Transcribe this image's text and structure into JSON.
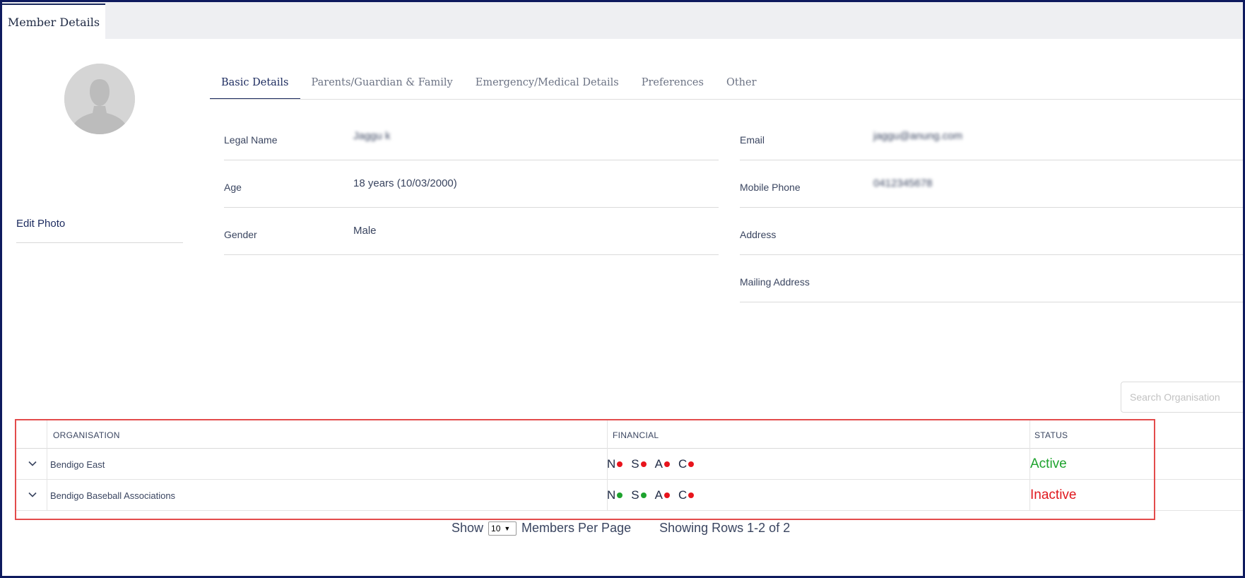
{
  "header": {
    "tab_label": "Member Details"
  },
  "profile": {
    "edit_photo_label": "Edit Photo"
  },
  "subtabs": [
    {
      "label": "Basic Details",
      "active": true
    },
    {
      "label": "Parents/Guardian & Family",
      "active": false
    },
    {
      "label": "Emergency/Medical Details",
      "active": false
    },
    {
      "label": "Preferences",
      "active": false
    },
    {
      "label": "Other",
      "active": false
    }
  ],
  "details_left": {
    "legal_name": {
      "label": "Legal Name",
      "value": "Jaggu k"
    },
    "age": {
      "label": "Age",
      "value": "18 years (10/03/2000)"
    },
    "gender": {
      "label": "Gender",
      "value": "Male"
    }
  },
  "details_right": {
    "email": {
      "label": "Email",
      "value": "jaggu@anung.com"
    },
    "mobile": {
      "label": "Mobile Phone",
      "value": "0412345678"
    },
    "address": {
      "label": "Address",
      "value": ""
    },
    "mailing": {
      "label": "Mailing Address",
      "value": ""
    }
  },
  "search": {
    "placeholder": "Search Organisation"
  },
  "table": {
    "columns": {
      "organisation": "ORGANISATION",
      "financial": "FINANCIAL",
      "status": "STATUS"
    },
    "rows": [
      {
        "organisation": "Bendigo East",
        "financial": [
          {
            "letter": "N",
            "status": "red"
          },
          {
            "letter": "S",
            "status": "red"
          },
          {
            "letter": "A",
            "status": "red"
          },
          {
            "letter": "C",
            "status": "red"
          }
        ],
        "status": "Active",
        "status_color": "#1ea32e"
      },
      {
        "organisation": "Bendigo Baseball Associations",
        "financial": [
          {
            "letter": "N",
            "status": "green"
          },
          {
            "letter": "S",
            "status": "green"
          },
          {
            "letter": "A",
            "status": "red"
          },
          {
            "letter": "C",
            "status": "red"
          }
        ],
        "status": "Inactive",
        "status_color": "#e0191f"
      }
    ]
  },
  "pagination": {
    "show_label": "Show",
    "per_page_value": "10",
    "per_page_label": "Members Per Page",
    "rows_label": "Showing Rows 1-2 of 2"
  },
  "colors": {
    "red_dot": "#e8141c",
    "green_dot": "#1ea32e",
    "accent": "#1b2a5e"
  }
}
